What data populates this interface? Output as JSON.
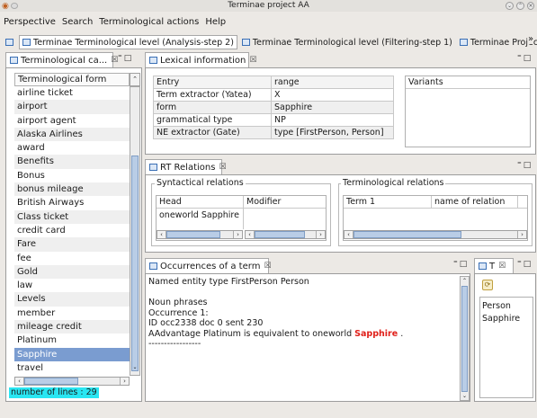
{
  "window": {
    "title": "Terminae project AA"
  },
  "menu": {
    "items": [
      "Perspective",
      "Search",
      "Terminological actions",
      "Help"
    ]
  },
  "editor_tabs": [
    {
      "label": "Terminae Terminological level (Analysis-step 2)",
      "active": true
    },
    {
      "label": "Terminae Terminological level (Filtering-step 1)",
      "active": false
    },
    {
      "label": "Terminae Project perp",
      "active": false
    }
  ],
  "editor_tabs_overflow": "»",
  "term_view": {
    "tab": "Terminological ca...",
    "header": "Terminological form",
    "items": [
      "airline ticket",
      "airport",
      "airport agent",
      "Alaska Airlines",
      "award",
      "Benefits",
      "Bonus",
      "bonus mileage",
      "British Airways",
      "Class ticket",
      "credit card",
      "Fare",
      "fee",
      "Gold",
      "law",
      "Levels",
      "member",
      "mileage credit",
      "Platinum",
      "Sapphire",
      "travel"
    ],
    "selected": "Sapphire",
    "count_label": "number of lines : 29"
  },
  "lexical": {
    "tab": "Lexical information",
    "columns": [
      "Entry",
      "range"
    ],
    "rows": [
      [
        "Term extractor (Yatea)",
        "X"
      ],
      [
        "form",
        "Sapphire"
      ],
      [
        "grammatical type",
        "NP"
      ],
      [
        "NE extractor (Gate)",
        "type [FirstPerson, Person]"
      ]
    ],
    "variants_header": "Variants"
  },
  "relations": {
    "tab": "RT Relations",
    "syntactic_title": "Syntactical relations",
    "syntactic_columns": [
      "Head",
      "Modifier"
    ],
    "syntactic_rows": [
      [
        "oneworld Sapphire",
        ""
      ]
    ],
    "terminological_title": "Terminological relations",
    "terminological_columns": [
      "Term 1",
      "name of relation"
    ]
  },
  "occurrences": {
    "tab": "Occurrences of a term",
    "named_entity": "Named entity type  FirstPerson Person",
    "noun_phrases": "Noun phrases",
    "occurrence_label": "Occurrence 1:",
    "id_line": "ID occ2338 doc 0 sent 230",
    "sentence_before": "AAdvantage Platinum is equivalent to oneworld ",
    "sentence_highlight": "Sapphire",
    "sentence_after": " .",
    "separator": "-----------------",
    "highlight_color": "#e0201a"
  },
  "types_view": {
    "tab": "T",
    "items": [
      "Person",
      "Sapphire"
    ]
  },
  "colors": {
    "selection": "#7a9cd0",
    "count_bg": "#29e6f2",
    "accent": "#3a6fb5"
  }
}
